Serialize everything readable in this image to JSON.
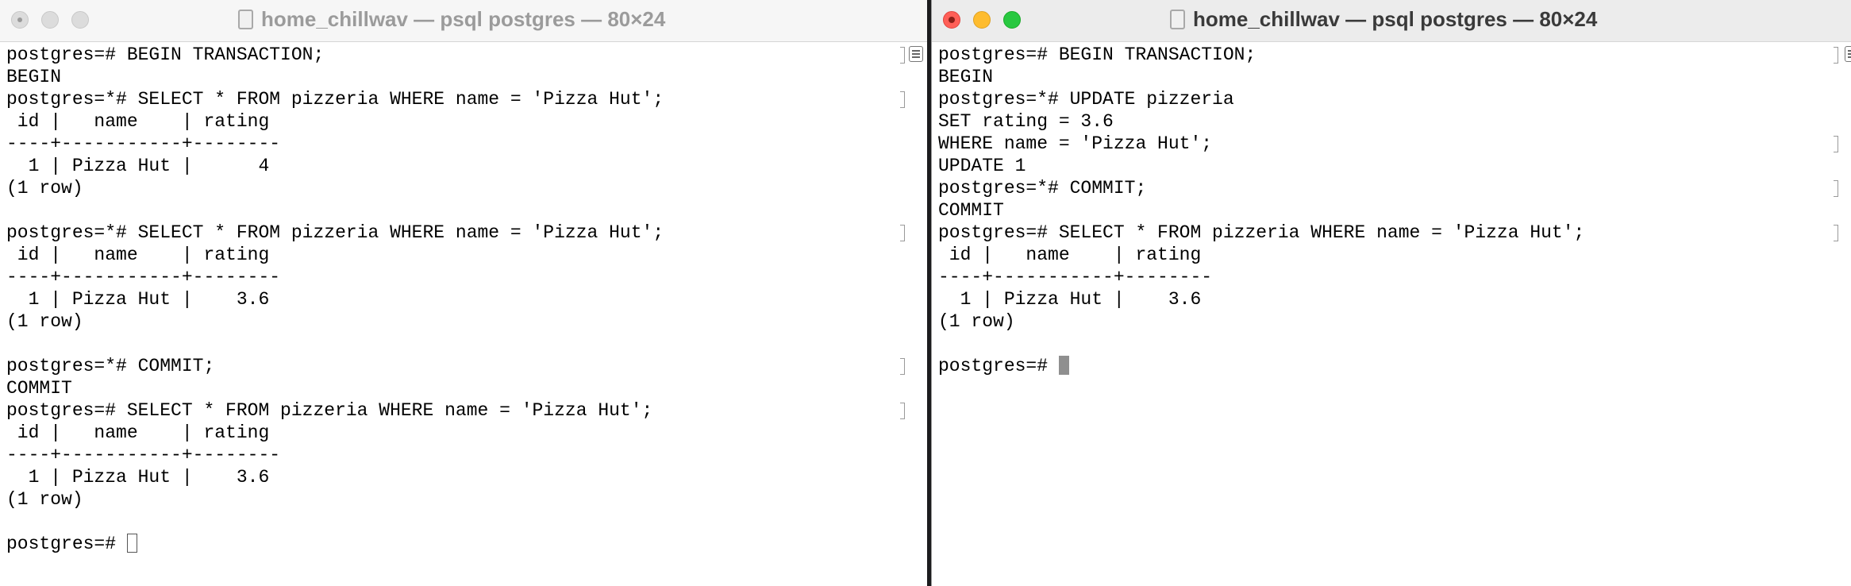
{
  "left_window": {
    "title": "home_chillwav — psql postgres — 80×24",
    "lines": [
      "postgres=# BEGIN TRANSACTION;",
      "BEGIN",
      "postgres=*# SELECT * FROM pizzeria WHERE name = 'Pizza Hut';",
      " id |   name    | rating",
      "----+-----------+--------",
      "  1 | Pizza Hut |      4",
      "(1 row)",
      "",
      "postgres=*# SELECT * FROM pizzeria WHERE name = 'Pizza Hut';",
      " id |   name    | rating",
      "----+-----------+--------",
      "  1 | Pizza Hut |    3.6",
      "(1 row)",
      "",
      "postgres=*# COMMIT;",
      "COMMIT",
      "postgres=# SELECT * FROM pizzeria WHERE name = 'Pizza Hut';",
      " id |   name    | rating",
      "----+-----------+--------",
      "  1 | Pizza Hut |    3.6",
      "(1 row)",
      ""
    ],
    "prompt": "postgres=# ",
    "marked_lines": [
      0,
      2,
      8,
      14,
      16
    ]
  },
  "right_window": {
    "title": "home_chillwav — psql postgres — 80×24",
    "lines": [
      "postgres=# BEGIN TRANSACTION;",
      "BEGIN",
      "postgres=*# UPDATE pizzeria",
      "SET rating = 3.6",
      "WHERE name = 'Pizza Hut';",
      "UPDATE 1",
      "postgres=*# COMMIT;",
      "COMMIT",
      "postgres=# SELECT * FROM pizzeria WHERE name = 'Pizza Hut';",
      " id |   name    | rating",
      "----+-----------+--------",
      "  1 | Pizza Hut |    3.6",
      "(1 row)",
      ""
    ],
    "prompt": "postgres=# ",
    "marked_lines": [
      0,
      4,
      6,
      8
    ]
  }
}
